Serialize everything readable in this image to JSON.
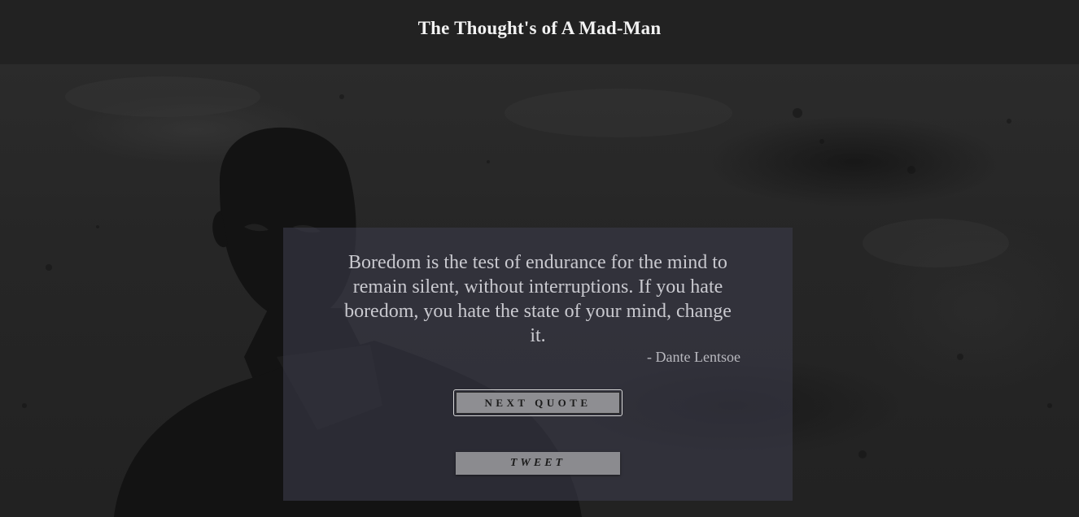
{
  "header": {
    "title": "The Thought's of A Mad-Man",
    "background_color": "#222222"
  },
  "quote": {
    "text": "Boredom is the test of endurance for the mind to remain silent, without interruptions. If you hate boredom, you hate the state of your mind, change it.",
    "author": "- Dante Lentsoe"
  },
  "buttons": {
    "next_label": "NEXT QUOTE",
    "tweet_label": "TWEET"
  },
  "background": {
    "image": "dark grunge texture with portrait of a man"
  }
}
